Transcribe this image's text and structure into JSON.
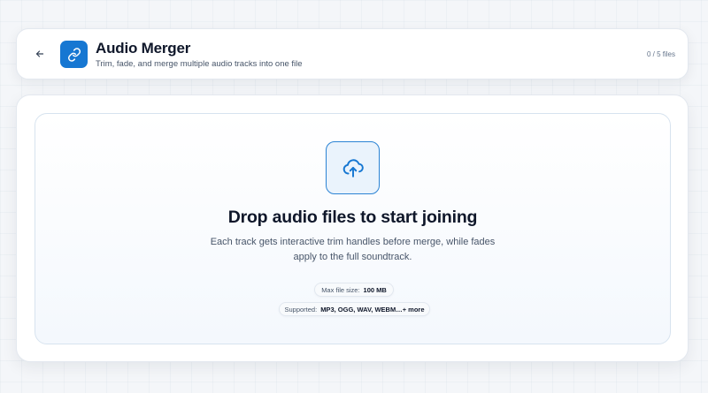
{
  "header": {
    "title": "Audio Merger",
    "subtitle": "Trim, fade, and merge multiple audio tracks into one file",
    "file_count": "0 / 5 files"
  },
  "icons": {
    "back": "arrow-left-icon",
    "app": "link-icon",
    "upload": "cloud-upload-icon"
  },
  "dropzone": {
    "title": "Drop audio files to start joining",
    "description_line1": "Each track gets interactive trim handles before merge, while fades",
    "description_line2": "apply to the full soundtrack.",
    "max_size_label": "Max file size:",
    "max_size_value": "100 MB",
    "supported_label": "Supported:",
    "supported_value": "MP3, OGG, WAV, WEBM…+ more"
  },
  "colors": {
    "accent": "#1677d2",
    "background": "#f4f6f9"
  }
}
